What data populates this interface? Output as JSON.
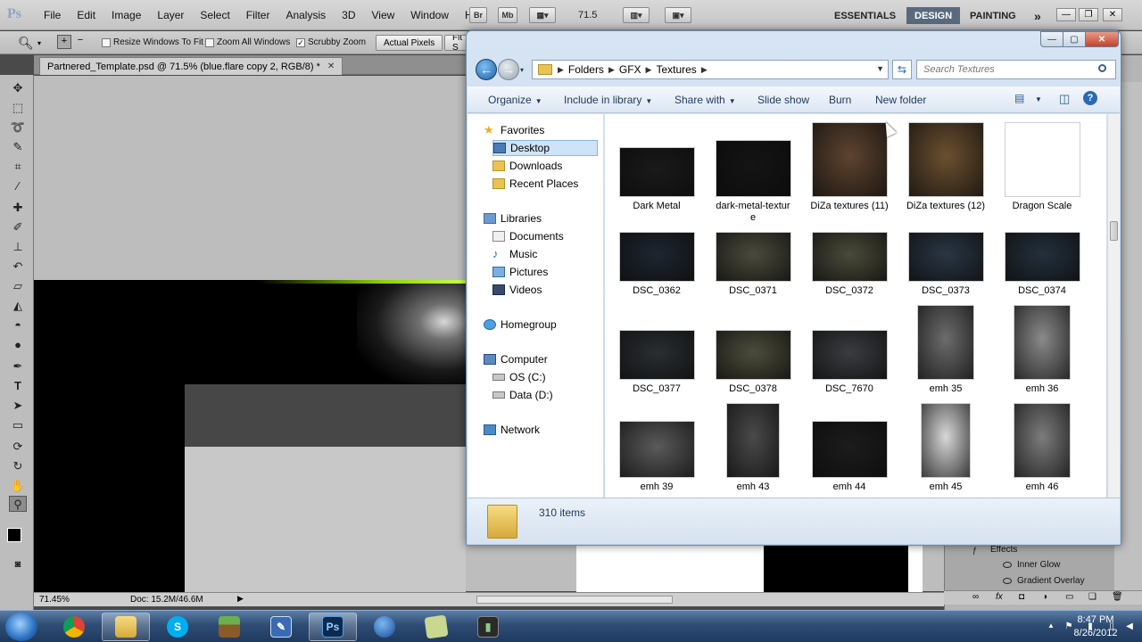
{
  "photoshop": {
    "logo": "Ps",
    "menu": [
      "File",
      "Edit",
      "Image",
      "Layer",
      "Select",
      "Filter",
      "Analysis",
      "3D",
      "View",
      "Window",
      "Help"
    ],
    "mini_buttons": [
      "Br",
      "Mb"
    ],
    "zoom_value": "71.5",
    "workspaces": [
      "ESSENTIALS",
      "DESIGN",
      "PAINTING"
    ],
    "active_workspace": "DESIGN",
    "more_workspaces": "»",
    "options": {
      "resize_windows": "Resize Windows To Fit",
      "zoom_all_windows": "Zoom All Windows",
      "scrubby_zoom": "Scrubby Zoom",
      "actual_pixels": "Actual Pixels",
      "fit_screen": "Fit S"
    },
    "document_tab": "Partnered_Template.psd @ 71.5% (blue.flare copy 2, RGB/8) *",
    "status": {
      "zoom": "71.45%",
      "doc": "Doc: 15.2M/46.6M"
    },
    "layers": {
      "effects": "Effects",
      "inner_glow": "Inner Glow",
      "gradient_overlay": "Gradient Overlay"
    }
  },
  "explorer": {
    "breadcrumbs": [
      "Folders",
      "GFX",
      "Textures"
    ],
    "search_placeholder": "Search Textures",
    "commands": {
      "organize": "Organize",
      "include_in_library": "Include in library",
      "share_with": "Share with",
      "slide_show": "Slide show",
      "burn": "Burn",
      "new_folder": "New folder"
    },
    "nav": {
      "favorites": "Favorites",
      "desktop": "Desktop",
      "downloads": "Downloads",
      "recent_places": "Recent Places",
      "libraries": "Libraries",
      "documents": "Documents",
      "music": "Music",
      "pictures": "Pictures",
      "videos": "Videos",
      "homegroup": "Homegroup",
      "computer": "Computer",
      "os_c": "OS (C:)",
      "data_d": "Data (D:)",
      "network": "Network"
    },
    "files": [
      {
        "name": "Dark Metal",
        "color": "#1a1a1a"
      },
      {
        "name": "dark-metal-texture",
        "color": "#141414"
      },
      {
        "name": "DiZa textures (11)",
        "color": "#5e4430"
      },
      {
        "name": "DiZa textures (12)",
        "color": "#6b5030"
      },
      {
        "name": "Dragon Scale",
        "color": "#ffffff"
      },
      {
        "name": "DSC_0362",
        "color": "#1e2630"
      },
      {
        "name": "DSC_0371",
        "color": "#4a4a3c"
      },
      {
        "name": "DSC_0372",
        "color": "#4a4a3a"
      },
      {
        "name": "DSC_0373",
        "color": "#2a3644"
      },
      {
        "name": "DSC_0374",
        "color": "#24303c"
      },
      {
        "name": "DSC_0377",
        "color": "#2a2e32"
      },
      {
        "name": "DSC_0378",
        "color": "#4c4c3c"
      },
      {
        "name": "DSC_7670",
        "color": "#3a3c40"
      },
      {
        "name": "emh 35",
        "color": "#6c6c6c"
      },
      {
        "name": "emh 36",
        "color": "#8a8a8a"
      },
      {
        "name": "emh 39",
        "color": "#5a5a5a"
      },
      {
        "name": "emh 43",
        "color": "#4a4a4a"
      },
      {
        "name": "emh 44",
        "color": "#1c1c1c"
      },
      {
        "name": "emh 45",
        "color": "#d8d8d8"
      },
      {
        "name": "emh 46",
        "color": "#7c7c7c"
      }
    ],
    "item_count": "310 items"
  },
  "taskbar": {
    "time": "8:47 PM",
    "date": "8/26/2012",
    "ps_label": "Ps"
  }
}
